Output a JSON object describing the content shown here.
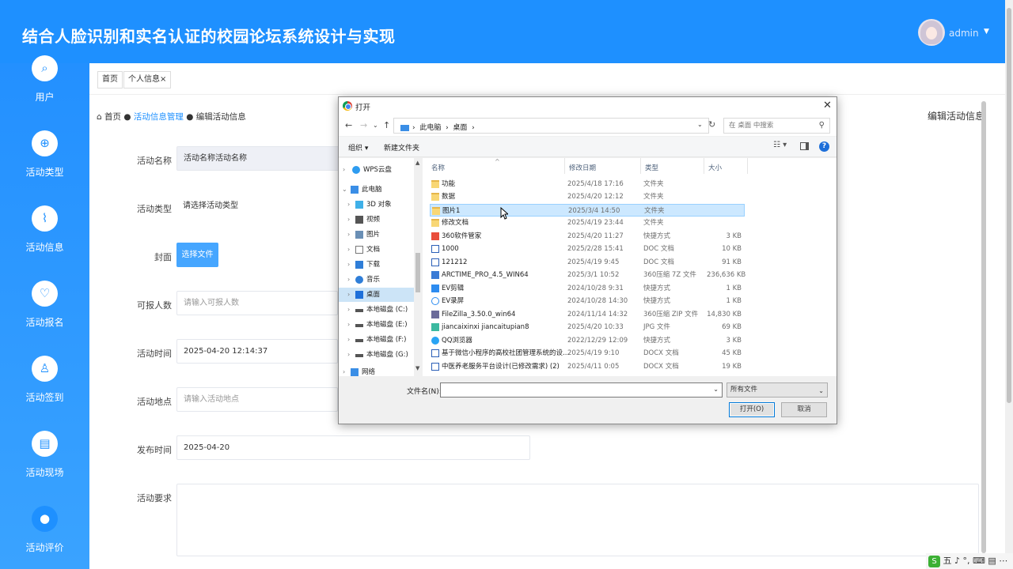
{
  "app": {
    "title": "结合人脸识别和实名认证的校园论坛系统设计与实现",
    "user": "admin"
  },
  "colors": {
    "primary": "#1e90ff",
    "sidebar": "#2390ff",
    "button": "#46a6ff"
  },
  "sidebar": {
    "items": [
      {
        "label": "用户",
        "icon": "search-icon"
      },
      {
        "label": "活动类型",
        "icon": "plus-circle-icon"
      },
      {
        "label": "活动信息",
        "icon": "chart-icon"
      },
      {
        "label": "活动报名",
        "icon": "heart-icon"
      },
      {
        "label": "活动签到",
        "icon": "user-icon"
      },
      {
        "label": "活动现场",
        "icon": "document-icon"
      },
      {
        "label": "活动评价",
        "icon": "comment-icon"
      }
    ]
  },
  "tabs": [
    {
      "label": "首页"
    },
    {
      "label": "个人信息",
      "close": "×"
    }
  ],
  "breadcrumb": {
    "home": "首页",
    "section": "活动信息管理",
    "current": "编辑活动信息"
  },
  "page_heading": "编辑活动信息",
  "form": {
    "name": {
      "label": "活动名称",
      "value": "活动名称活动名称"
    },
    "type": {
      "label": "活动类型",
      "placeholder": "请选择活动类型"
    },
    "cover": {
      "label": "封面",
      "button": "选择文件"
    },
    "capacity": {
      "label": "可报人数",
      "placeholder": "请输入可报人数"
    },
    "time": {
      "label": "活动时间",
      "value": "2025-04-20 12:14:37"
    },
    "location": {
      "label": "活动地点",
      "placeholder": "请输入活动地点"
    },
    "publish": {
      "label": "发布时间",
      "value": "2025-04-20"
    },
    "requirement": {
      "label": "活动要求"
    }
  },
  "dialog": {
    "title": "打开",
    "address": {
      "root": "此电脑",
      "current": "桌面"
    },
    "search_placeholder": "在 桌面 中搜索",
    "toolbar": {
      "organize": "组织 ▾",
      "new_folder": "新建文件夹"
    },
    "tree": [
      {
        "label": "WPS云盘",
        "chev": "›"
      },
      {
        "label": "此电脑",
        "chev": "⌄"
      },
      {
        "label": "3D 对象",
        "chev": "›"
      },
      {
        "label": "视频",
        "chev": "›"
      },
      {
        "label": "图片",
        "chev": "›"
      },
      {
        "label": "文档",
        "chev": "›"
      },
      {
        "label": "下载",
        "chev": "›"
      },
      {
        "label": "音乐",
        "chev": "›"
      },
      {
        "label": "桌面",
        "chev": "›",
        "selected": true
      },
      {
        "label": "本地磁盘 (C:)",
        "chev": "›"
      },
      {
        "label": "本地磁盘 (E:)",
        "chev": "›"
      },
      {
        "label": "本地磁盘 (F:)",
        "chev": "›"
      },
      {
        "label": "本地磁盘 (G:)",
        "chev": "›"
      },
      {
        "label": "网络",
        "chev": "›"
      }
    ],
    "columns": {
      "name": "名称",
      "date": "修改日期",
      "type": "类型",
      "size": "大小"
    },
    "files": [
      {
        "name": "功能",
        "date": "2025/4/18 17:16",
        "type": "文件夹",
        "size": "",
        "kind": "folder"
      },
      {
        "name": "数据",
        "date": "2025/4/20 12:12",
        "type": "文件夹",
        "size": "",
        "kind": "folder"
      },
      {
        "name": "图片1",
        "date": "2025/3/4 14:50",
        "type": "文件夹",
        "size": "",
        "kind": "folder",
        "selected": true
      },
      {
        "name": "修改文档",
        "date": "2025/4/19 23:44",
        "type": "文件夹",
        "size": "",
        "kind": "folder"
      },
      {
        "name": "360软件管家",
        "date": "2025/4/20 11:27",
        "type": "快捷方式",
        "size": "3 KB",
        "kind": "exe"
      },
      {
        "name": "1000",
        "date": "2025/2/28 15:41",
        "type": "DOC 文档",
        "size": "10 KB",
        "kind": "doc"
      },
      {
        "name": "121212",
        "date": "2025/4/19 9:45",
        "type": "DOC 文档",
        "size": "91 KB",
        "kind": "doc"
      },
      {
        "name": "ARCTIME_PRO_4.5_WIN64",
        "date": "2025/3/1 10:52",
        "type": "360压缩 7Z 文件",
        "size": "236,636 KB",
        "kind": "exe"
      },
      {
        "name": "EV剪辑",
        "date": "2024/10/28 9:31",
        "type": "快捷方式",
        "size": "1 KB",
        "kind": "exe"
      },
      {
        "name": "EV录屏",
        "date": "2024/10/28 14:30",
        "type": "快捷方式",
        "size": "1 KB",
        "kind": "exe"
      },
      {
        "name": "FileZilla_3.50.0_win64",
        "date": "2024/11/14 14:32",
        "type": "360压缩 ZIP 文件",
        "size": "14,830 KB",
        "kind": "exe"
      },
      {
        "name": "jiancaixinxi jiancaitupian8",
        "date": "2025/4/20 10:33",
        "type": "JPG 文件",
        "size": "69 KB",
        "kind": "img"
      },
      {
        "name": "QQ浏览器",
        "date": "2022/12/29 12:09",
        "type": "快捷方式",
        "size": "3 KB",
        "kind": "exe"
      },
      {
        "name": "基于微信小程序的高校社团管理系统的设...",
        "date": "2025/4/19 9:10",
        "type": "DOCX 文档",
        "size": "45 KB",
        "kind": "doc"
      },
      {
        "name": "中医养老服务平台设计(已修改需求) (2)",
        "date": "2025/4/11 0:05",
        "type": "DOCX 文档",
        "size": "19 KB",
        "kind": "doc"
      }
    ],
    "filename_label": "文件名(N):",
    "filetype": "所有文件",
    "open_button": "打开(O)",
    "cancel_button": "取消"
  },
  "ime": {
    "logo": "S",
    "text": "五 ♪ °, ⌨ ▤ ⋯"
  }
}
